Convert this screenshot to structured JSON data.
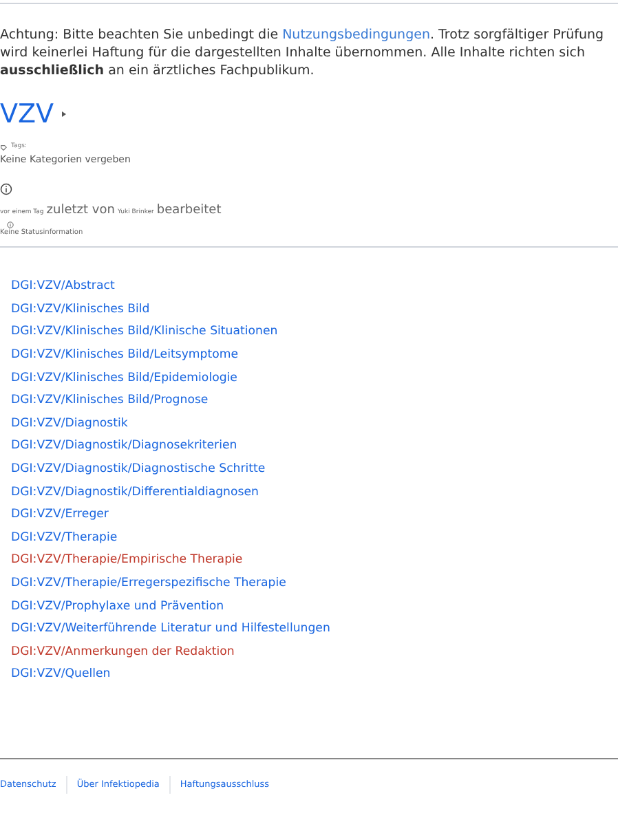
{
  "notice": {
    "before": "Achtung: Bitte beachten Sie unbedingt die ",
    "link": "Nutzungsbedingungen",
    "after": ". Trotz sorgfältiger Prüfung wird keinerlei Haftung für die dargestellten Inhalte übernommen. Alle Inhalte richten sich **ausschließlich** an ein ärztliches Fachpublikum."
  },
  "page_title": "VZV",
  "tags": {
    "label": "Tags:",
    "value": "Keine Kategorien vergeben"
  },
  "edit_info": {
    "time": "vor einem Tag",
    "by": "zuletzt von",
    "user": "Yuki Brinker",
    "action": "bearbeitet"
  },
  "status": "Keine Statusinformation",
  "links": [
    {
      "text": "DGI:VZV/Abstract",
      "missing": false
    },
    {
      "text": "DGI:VZV/Klinisches Bild",
      "missing": false
    },
    {
      "text": "DGI:VZV/Klinisches Bild/Klinische Situationen",
      "missing": false
    },
    {
      "text": "DGI:VZV/Klinisches Bild/Leitsymptome",
      "missing": false
    },
    {
      "text": "DGI:VZV/Klinisches Bild/Epidemiologie",
      "missing": false
    },
    {
      "text": "DGI:VZV/Klinisches Bild/Prognose",
      "missing": false
    },
    {
      "text": "DGI:VZV/Diagnostik",
      "missing": false
    },
    {
      "text": "DGI:VZV/Diagnostik/Diagnosekriterien",
      "missing": false
    },
    {
      "text": "DGI:VZV/Diagnostik/Diagnostische Schritte",
      "missing": false
    },
    {
      "text": "DGI:VZV/Diagnostik/Differentialdiagnosen",
      "missing": false
    },
    {
      "text": "DGI:VZV/Erreger",
      "missing": false
    },
    {
      "text": "DGI:VZV/Therapie",
      "missing": false
    },
    {
      "text": "DGI:VZV/Therapie/Empirische Therapie",
      "missing": true
    },
    {
      "text": "DGI:VZV/Therapie/Erregerspezifische Therapie",
      "missing": false
    },
    {
      "text": "DGI:VZV/Prophylaxe und Prävention",
      "missing": false
    },
    {
      "text": "DGI:VZV/Weiterführende Literatur und Hilfestellungen",
      "missing": false
    },
    {
      "text": "DGI:VZV/Anmerkungen der Redaktion",
      "missing": true
    },
    {
      "text": "DGI:VZV/Quellen",
      "missing": false
    }
  ],
  "footer_links": [
    "Datenschutz",
    "Über Infektiopedia",
    "Haftungsausschluss"
  ]
}
